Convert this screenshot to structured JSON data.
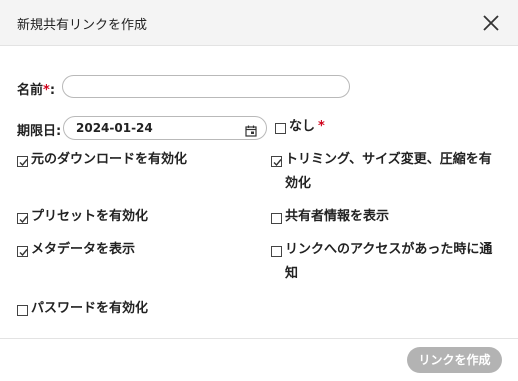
{
  "dialog": {
    "title": "新規共有リンクを作成",
    "close_icon": "close-icon"
  },
  "form": {
    "name_label": "名前",
    "name_value": "",
    "required_mark": "*",
    "label_colon": ":",
    "expiry_label": "期限日:",
    "expiry_value": "2024-01-24",
    "calendar_icon": "calendar-icon",
    "no_expiry_label": "なし"
  },
  "options": [
    {
      "label": "元のダウンロードを有効化",
      "checked": true
    },
    {
      "label": "トリミング、サイズ変更、圧縮を有効化",
      "line1": "トリミング、サイズ変更、圧縮を有",
      "line2": "効化",
      "checked": true
    },
    {
      "label": "プリセットを有効化",
      "checked": true
    },
    {
      "label": "共有者情報を表示",
      "checked": false
    },
    {
      "label": "メタデータを表示",
      "checked": true
    },
    {
      "label": "リンクへのアクセスがあった時に通知",
      "line1": "リンクへのアクセスがあった時に通",
      "line2": "知",
      "checked": false
    },
    {
      "label": "パスワードを有効化",
      "checked": false
    }
  ],
  "no_expiry_checked": false,
  "footer": {
    "create_label": "リンクを作成"
  },
  "colors": {
    "required": "#d0021b",
    "header_bg": "#f4f4f4",
    "button_disabled": "#b3b3b3"
  }
}
